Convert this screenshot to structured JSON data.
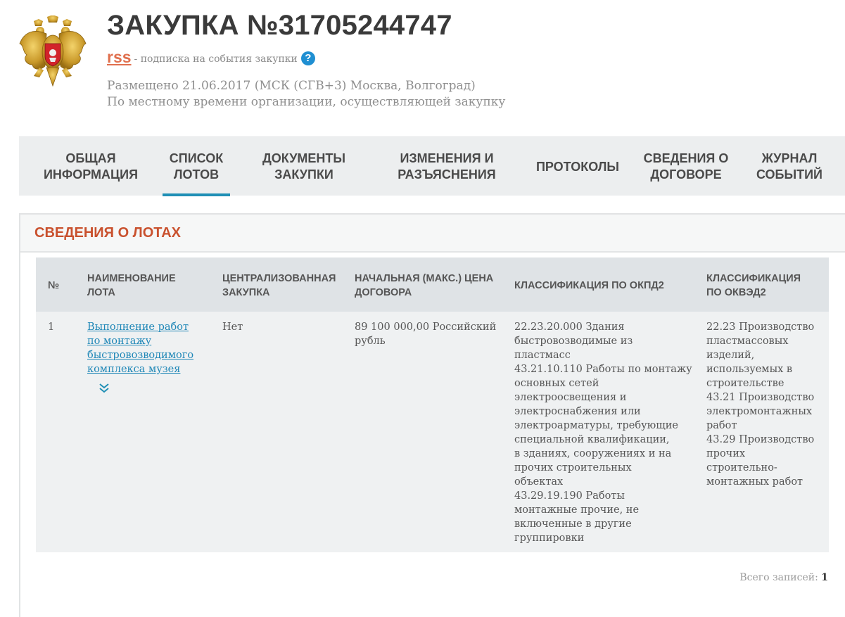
{
  "header": {
    "title": "ЗАКУПКА №31705244747",
    "rss_label": "rss",
    "rss_note": "- подписка на события закупки",
    "help_glyph": "?",
    "placed": "Размещено 21.06.2017 (МСК (СГВ+3) Москва, Волгоград)",
    "timezone_note": "По местному времени организации, осуществляющей закупку"
  },
  "tabs": [
    {
      "line1": "Общая",
      "line2": "информация"
    },
    {
      "line1": "Список",
      "line2": "лотов",
      "active": true
    },
    {
      "line1": "Документы",
      "line2": "закупки"
    },
    {
      "line1": "Изменения и",
      "line2": "разъяснения"
    },
    {
      "line1": "Протоколы",
      "line2": ""
    },
    {
      "line1": "Сведения о",
      "line2": "договоре"
    },
    {
      "line1": "Журнал",
      "line2": "событий"
    }
  ],
  "lots": {
    "title": "Сведения о лотах",
    "columns": {
      "num": "№",
      "name": [
        "Наименование",
        "лота"
      ],
      "centralized": [
        "Централизованная",
        "закупка"
      ],
      "price": [
        "Начальная (макс.) цена",
        "договора"
      ],
      "okpd2": "Классификация по ОКПД2",
      "okved2": [
        "Классификация",
        "по ОКВЭД2"
      ]
    },
    "rows": [
      {
        "num": "1",
        "name": [
          "Выполнение работ",
          "по монтажу",
          "быстровозводимого",
          "комплекса музея"
        ],
        "centralized": "Нет",
        "price": [
          "89 100 000,00 Российский",
          "рубль"
        ],
        "okpd2": [
          "22.23.20.000 Здания",
          "быстровозводимые из",
          "пластмасс",
          "43.21.10.110 Работы по монтажу",
          "основных сетей",
          "электроосвещения и",
          "электроснабжения или",
          "электроарматуры, требующие",
          "специальной квалификации,",
          "в зданиях, сооружениях и на",
          "прочих строительных",
          "объектах",
          "43.29.19.190 Работы",
          "монтажные прочие, не",
          "включенные в другие",
          "группировки"
        ],
        "okved2": [
          "22.23 Производство",
          "пластмассовых",
          "изделий,",
          "используемых в",
          "строительстве",
          "43.21 Производство",
          "электромонтажных",
          "работ",
          "43.29 Производство",
          "прочих",
          "строительно-",
          "монтажных работ"
        ]
      }
    ],
    "total_label": "Всего записей:",
    "total_value": "1"
  },
  "colors": {
    "accent": "#1f8fb5",
    "section_title": "#c9512e",
    "rss": "#e0704e",
    "link": "#1f87b7"
  },
  "icons": {
    "emblem": "russian-coat-of-arms",
    "help": "question-circle-icon",
    "expand": "double-chevron-down-icon"
  }
}
